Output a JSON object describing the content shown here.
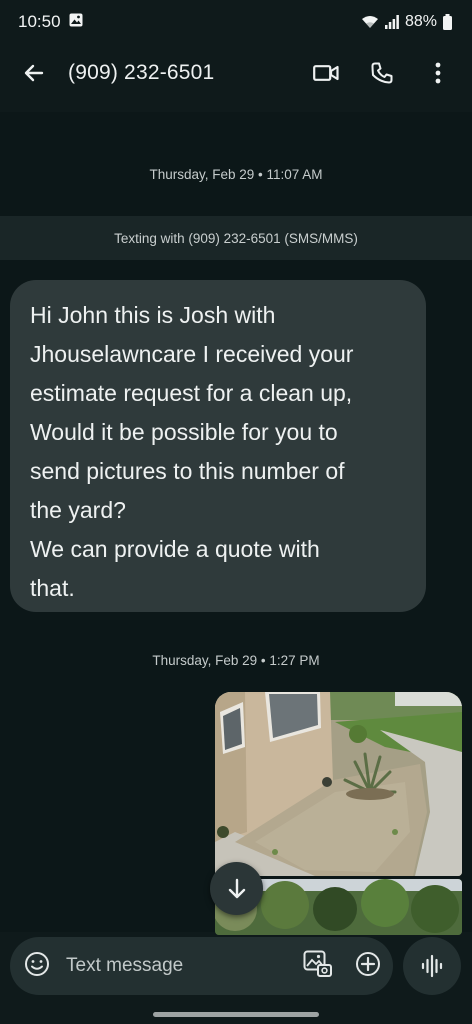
{
  "status_bar": {
    "time": "10:50",
    "battery": "88%"
  },
  "header": {
    "contact": "(909) 232-6501",
    "back_icon": "arrow-left-icon",
    "video_icon": "video-camera-icon",
    "call_icon": "phone-icon",
    "menu_icon": "more-vertical-icon"
  },
  "thread": {
    "timestamp_1": "Thursday, Feb 29 • 11:07 AM",
    "texting_with": "Texting with (909) 232-6501 (SMS/MMS)",
    "message_1": "Hi John this is Josh with\nJhouselawncare I received your\nestimate request for a clean up,\nWould it be possible for you to\nsend pictures to this number of\nthe yard?\nWe can provide a quote with\nthat.",
    "timestamp_2": "Thursday, Feb 29 • 1:27 PM"
  },
  "composer": {
    "placeholder": "Text message",
    "emoji_icon": "emoji-icon",
    "gallery_icon": "gallery-icon",
    "add_icon": "add-circle-icon",
    "voice_icon": "voice-wave-icon"
  },
  "colors": {
    "background": "#0f1a1b",
    "bubble": "#2f3a3b",
    "compose_bar": "#233031"
  }
}
